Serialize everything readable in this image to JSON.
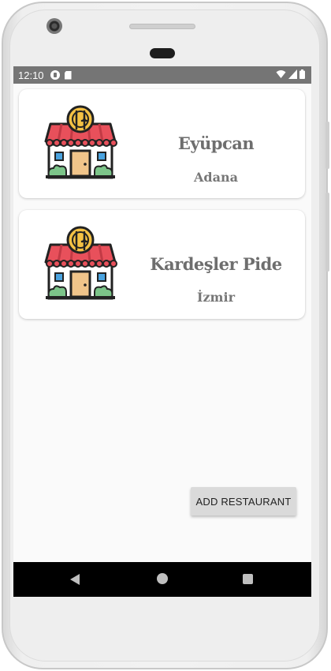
{
  "status_bar": {
    "time": "12:10",
    "icons": [
      "app-notification-icon",
      "sd-card-icon",
      "wifi-icon",
      "signal-icon",
      "battery-icon"
    ]
  },
  "restaurants": [
    {
      "name": "Eyüpcan",
      "city": "Adana",
      "icon": "restaurant-store-icon"
    },
    {
      "name": "Kardeşler Pide",
      "city": "İzmir",
      "icon": "restaurant-store-icon"
    }
  ],
  "add_button": {
    "label": "ADD RESTAURANT"
  },
  "nav_bar": {
    "icons": [
      "back-icon",
      "home-icon",
      "recents-icon"
    ]
  },
  "colors": {
    "status_bar": "#757575",
    "awning_red": "#e8505b",
    "plate_yellow": "#f5c244",
    "door": "#f0c48a",
    "window": "#4aa3df",
    "bush": "#7cc489",
    "text_gray": "#6e6e6e"
  }
}
